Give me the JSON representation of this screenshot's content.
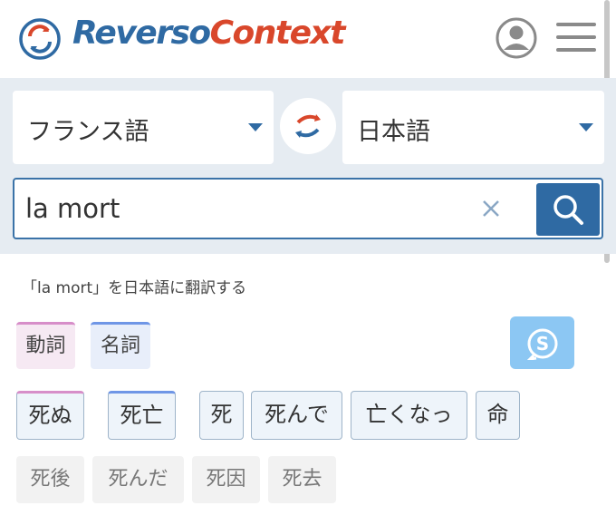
{
  "header": {
    "logo_reverso": "Reverso",
    "logo_context": "Context",
    "user_icon": "user-circle-icon",
    "menu_icon": "hamburger-menu-icon"
  },
  "search": {
    "source_language": "フランス語",
    "target_language": "日本語",
    "query": "la mort",
    "swap_icon": "swap-arrows-icon",
    "clear_icon": "close-icon",
    "search_icon": "search-icon"
  },
  "subtitle": "「la mort」を日本語に翻訳する",
  "filters": [
    {
      "label": "動詞",
      "kind": "verb"
    },
    {
      "label": "名詞",
      "kind": "noun"
    }
  ],
  "translations": [
    {
      "label": "死ぬ",
      "kind": "verb"
    },
    {
      "label": "死亡",
      "kind": "noun"
    },
    {
      "label": "死",
      "kind": "plain"
    },
    {
      "label": "死んで",
      "kind": "plain"
    },
    {
      "label": "亡くなっ",
      "kind": "plain"
    },
    {
      "label": "命",
      "kind": "plain"
    }
  ],
  "more_translations": [
    {
      "label": "死後"
    },
    {
      "label": "死んだ"
    },
    {
      "label": "死因"
    },
    {
      "label": "死去"
    }
  ],
  "colors": {
    "brand_blue": "#2f6aa3",
    "brand_red": "#d9472b",
    "panel_bg": "#e6ecf2",
    "verb_accent": "#d78ec9",
    "noun_accent": "#6f96e6",
    "speak_button": "#8cc7f3"
  },
  "side_button_icon": "synonyms-s-icon"
}
